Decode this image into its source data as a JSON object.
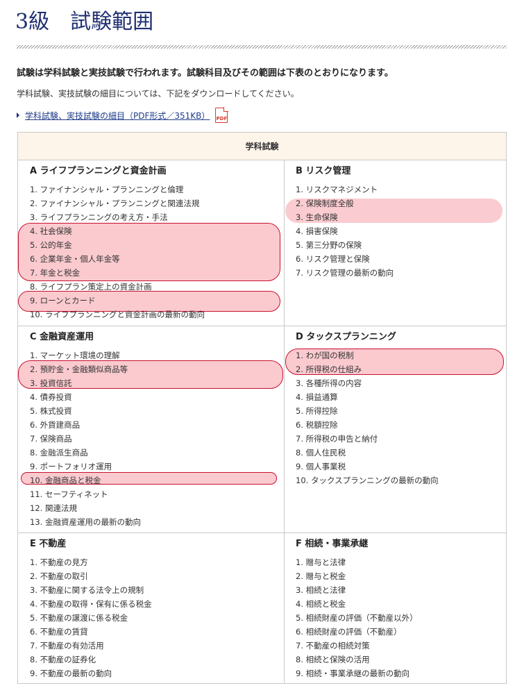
{
  "page": {
    "title": "3級　試験範囲",
    "lead": "試験は学科試験と実技試験で行われます。試験科目及びその範囲は下表のとおりになります。",
    "sub": "学科試験、実技試験の細目については、下記をダウンロードしてください。",
    "download_link": "学科試験、実技試験の細目（PDF形式／351KB）",
    "pdf_icon_label": "PDF"
  },
  "table": {
    "header": "学科試験",
    "sections": [
      {
        "heading": "A ライフプランニングと資金計画",
        "items": [
          "1. ファイナンシャル・プランニングと倫理",
          "2. ファイナンシャル・プランニングと関連法規",
          "3. ライフプランニングの考え方・手法",
          "4. 社会保険",
          "5. 公的年金",
          "6. 企業年金・個人年金等",
          "7. 年金と税金",
          "8. ライフプラン策定上の資金計画",
          "9. ローンとカード",
          "10. ライフプランニングと資金計画の最新の動向"
        ]
      },
      {
        "heading": "B リスク管理",
        "items": [
          "1. リスクマネジメント",
          "2. 保険制度全般",
          "3. 生命保険",
          "4. 損害保険",
          "5. 第三分野の保険",
          "6. リスク管理と保険",
          "7. リスク管理の最新の動向"
        ]
      },
      {
        "heading": "C 金融資産運用",
        "items": [
          "1. マーケット環境の理解",
          "2. 預貯金・金融類似商品等",
          "3. 投資信託",
          "4. 債券投資",
          "5. 株式投資",
          "6. 外貨建商品",
          "7. 保険商品",
          "8. 金融派生商品",
          "9. ポートフォリオ運用",
          "10. 金融商品と税金",
          "11. セーフティネット",
          "12. 関連法規",
          "13. 金融資産運用の最新の動向"
        ]
      },
      {
        "heading": "D タックスプランニング",
        "items": [
          "1. わが国の税制",
          "2. 所得税の仕組み",
          "3. 各種所得の内容",
          "4. 損益通算",
          "5. 所得控除",
          "6. 税額控除",
          "7. 所得税の申告と納付",
          "8. 個人住民税",
          "9. 個人事業税",
          "10. タックスプランニングの最新の動向"
        ]
      },
      {
        "heading": "E 不動産",
        "items": [
          "1. 不動産の見方",
          "2. 不動産の取引",
          "3. 不動産に関する法令上の規制",
          "4. 不動産の取得・保有に係る税金",
          "5. 不動産の譲渡に係る税金",
          "6. 不動産の賃貸",
          "7. 不動産の有効活用",
          "8. 不動産の証券化",
          "9. 不動産の最新の動向"
        ]
      },
      {
        "heading": "F 相続・事業承継",
        "items": [
          "1. 贈与と法律",
          "2. 贈与と税金",
          "3. 相続と法律",
          "4. 相続と税金",
          "5. 相続財産の評価（不動産以外）",
          "6. 相続財産の評価（不動産）",
          "7. 不動産の相続対策",
          "8. 相続と保険の活用",
          "9. 相続・事業承継の最新の動向"
        ]
      }
    ]
  },
  "colors": {
    "title": "#1f2f73",
    "link": "#1f3c88",
    "highlight_fill": "#f696a0",
    "highlight_border": "#c8102e",
    "table_header_bg": "#fdf5ea",
    "pdf_icon": "#d83a2b"
  }
}
